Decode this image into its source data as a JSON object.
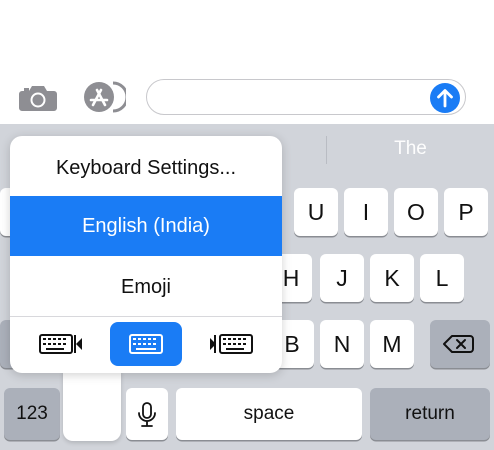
{
  "input_bar": {
    "camera_icon": "camera-icon",
    "appstore_icon": "app-store-icon",
    "message_placeholder": "",
    "send_icon": "arrow-up-icon"
  },
  "keyboard": {
    "predictions": [
      "",
      "",
      "The"
    ],
    "rows": {
      "row1": [
        "U",
        "I",
        "O",
        "P"
      ],
      "row2": [
        "H",
        "J",
        "K",
        "L"
      ],
      "row3": [
        "B",
        "N",
        "M"
      ]
    },
    "numbers_key": "123",
    "space_key": "space",
    "return_key": "return",
    "mic_icon": "microphone-icon",
    "backspace_icon": "delete-backward-icon"
  },
  "popover": {
    "settings": "Keyboard Settings...",
    "selected_language": "English (India)",
    "emoji": "Emoji",
    "modes": [
      "keyboard-left-icon",
      "keyboard-full-icon",
      "keyboard-right-icon"
    ]
  },
  "colors": {
    "accent": "#1a7cf5",
    "keyboard_bg": "#d1d4da",
    "key_bg": "#ffffff",
    "dark_key_bg": "#abb0ba"
  }
}
